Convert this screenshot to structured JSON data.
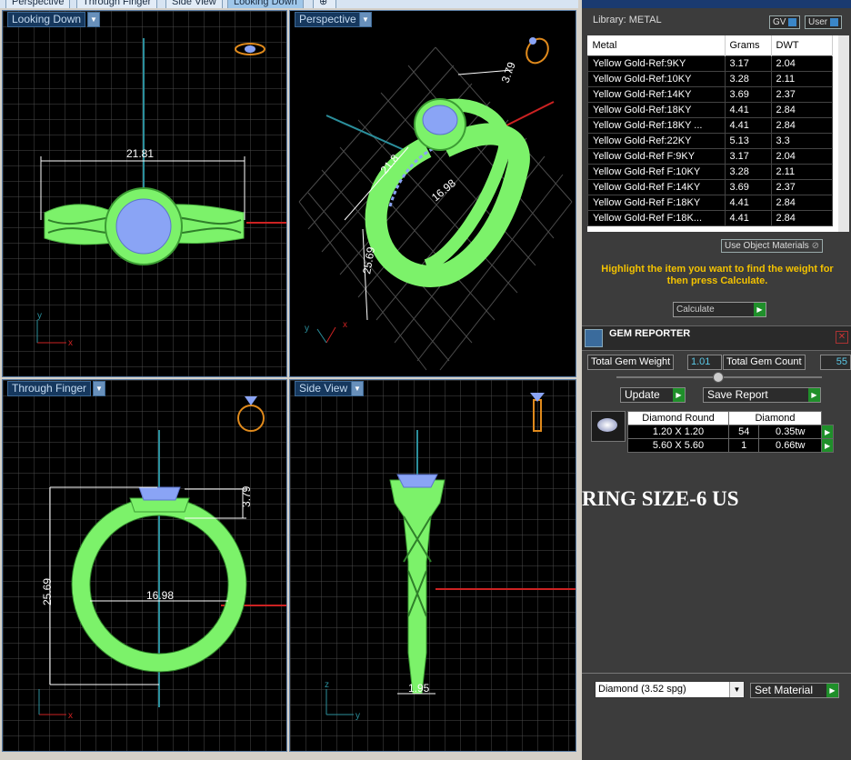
{
  "tabs": [
    "Perspective",
    "Through Finger",
    "Side View",
    "Looking Down"
  ],
  "tab_add_icon": "pin-icon",
  "viewports": {
    "top_left": {
      "label": "Looking Down",
      "dim_width": "21.81"
    },
    "top_right": {
      "label": "Perspective",
      "dim_a": "21.8",
      "dim_b": "16.98",
      "dim_c": "25.69",
      "dim_d": "3.79"
    },
    "bottom_left": {
      "label": "Through Finger",
      "dim_height": "25.69",
      "dim_inner": "16.98",
      "dim_top": "3.79"
    },
    "bottom_right": {
      "label": "Side View",
      "dim_bottom": "1.95"
    }
  },
  "axes": {
    "x": "x",
    "y": "y",
    "z": "z"
  },
  "library": {
    "title": "Library: METAL",
    "gv_label": "GV",
    "user_label": "User",
    "columns": [
      "Metal",
      "Grams",
      "DWT"
    ],
    "rows": [
      [
        "Yellow Gold-Ref:9KY",
        "3.17",
        "2.04"
      ],
      [
        "Yellow Gold-Ref:10KY",
        "3.28",
        "2.11"
      ],
      [
        "Yellow Gold-Ref:14KY",
        "3.69",
        "2.37"
      ],
      [
        "Yellow Gold-Ref:18KY",
        "4.41",
        "2.84"
      ],
      [
        "Yellow Gold-Ref:18KY ...",
        "4.41",
        "2.84"
      ],
      [
        "Yellow Gold-Ref:22KY",
        "5.13",
        "3.3"
      ],
      [
        "Yellow Gold-Ref F:9KY",
        "3.17",
        "2.04"
      ],
      [
        "Yellow Gold-Ref F:10KY",
        "3.28",
        "2.11"
      ],
      [
        "Yellow Gold-Ref F:14KY",
        "3.69",
        "2.37"
      ],
      [
        "Yellow Gold-Ref F:18KY",
        "4.41",
        "2.84"
      ],
      [
        "Yellow Gold-Ref F:18K...",
        "4.41",
        "2.84"
      ]
    ],
    "use_object_materials": "Use Object Materials",
    "hint": "Highlight the item you want to find the weight for then press Calculate.",
    "calculate_label": "Calculate"
  },
  "gem_reporter": {
    "title": "GEM REPORTER",
    "total_weight_label": "Total Gem Weight",
    "total_weight_value": "1.01",
    "total_count_label": "Total Gem Count",
    "total_count_value": "55",
    "update_label": "Update",
    "save_report_label": "Save Report",
    "table_headers": [
      "Diamond Round",
      "Diamond"
    ],
    "rows": [
      {
        "size": "1.20 X 1.20",
        "count": "54",
        "weight": "0.35tw"
      },
      {
        "size": "5.60 X 5.60",
        "count": "1",
        "weight": "0.66tw"
      }
    ],
    "material_select": "Diamond     (3.52 spg)",
    "set_material_label": "Set Material"
  },
  "ring_size_text": "RING SIZE-6 US",
  "colors": {
    "wire": "#7cf26a",
    "gem": "#8aa4f5",
    "grid": "#4a4a4a",
    "accent": "#1f8f2a"
  }
}
